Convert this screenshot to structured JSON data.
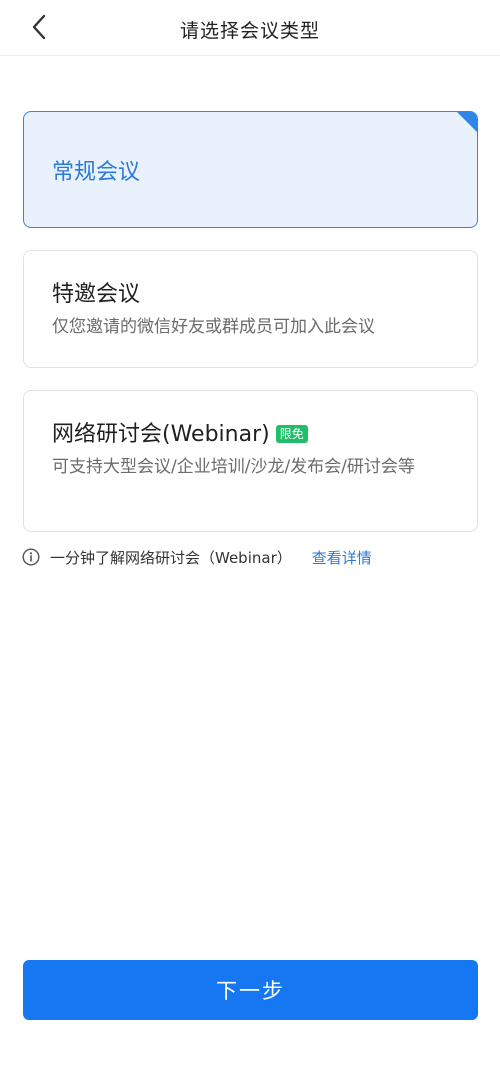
{
  "header": {
    "title": "请选择会议类型",
    "back_icon": "chevron-left-icon"
  },
  "options": [
    {
      "title": "常规会议",
      "description": "",
      "selected": true
    },
    {
      "title": "特邀会议",
      "description": "仅您邀请的微信好友或群成员可加入此会议",
      "selected": false
    },
    {
      "title": "网络研讨会(Webinar)",
      "badge": "限免",
      "description": "可支持大型会议/企业培训/沙龙/发布会/研讨会等",
      "selected": false
    }
  ],
  "info": {
    "icon": "info-icon",
    "text": "一分钟了解网络研讨会（Webinar）",
    "link": "查看详情"
  },
  "footer": {
    "next_label": "下一步"
  },
  "colors": {
    "accent": "#1677f2",
    "selected_bg": "#e8f1fc",
    "selected_border": "#2f86e6",
    "badge_green": "#1fbf6a"
  }
}
